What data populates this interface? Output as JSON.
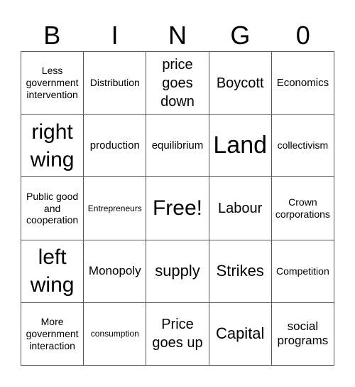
{
  "header": {
    "letters": [
      "B",
      "I",
      "N",
      "G",
      "0"
    ]
  },
  "grid": {
    "rows": [
      [
        "Less government intervention",
        "Distribution",
        "price goes down",
        "Boycott",
        "Economics"
      ],
      [
        "right wing",
        "production",
        "equilibrium",
        "Land",
        "collectivism"
      ],
      [
        "Public good and cooperation",
        "Entrepreneurs",
        "Free!",
        "Labour",
        "Crown corporations"
      ],
      [
        "left wing",
        "Monopoly",
        "supply",
        "Strikes",
        "Competition"
      ],
      [
        "More government interaction",
        "consumption",
        "Price goes up",
        "Capital",
        "social programs"
      ]
    ]
  },
  "colors": {
    "border": "#555555",
    "text": "#000000",
    "background": "#ffffff"
  }
}
